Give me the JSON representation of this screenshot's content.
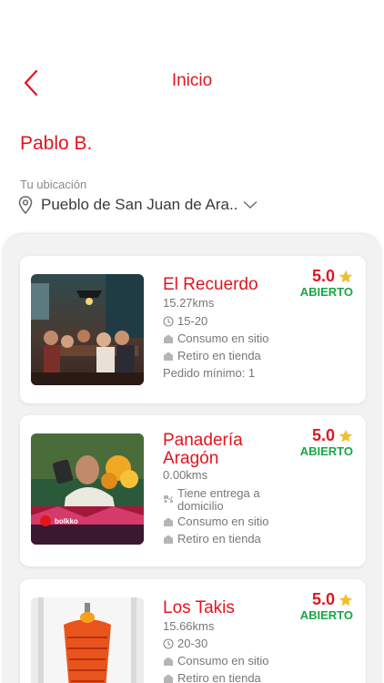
{
  "header": {
    "title": "Inicio",
    "back_icon": "chevron-left-icon"
  },
  "user": {
    "name": "Pablo B."
  },
  "location": {
    "label": "Tu ubicación",
    "value": "Pueblo de San Juan de Ara..",
    "icon": "location-pin-icon"
  },
  "colors": {
    "brand": "#e3141d",
    "open": "#19a646",
    "star": "#f2bd2f"
  },
  "restaurants": [
    {
      "name": "El Recuerdo",
      "distance": "15.27kms",
      "rating": "5.0",
      "status": "ABIERTO",
      "time": "15-20",
      "features": [
        "Consumo en sitio",
        "Retiro en tienda"
      ],
      "min_order": "Pedido mínimo: 1"
    },
    {
      "name_line1": "Panadería",
      "name_line2": "Aragón",
      "distance": "0.00kms",
      "rating": "5.0",
      "status": "ABIERTO",
      "delivery": "Tiene entrega a domicilio",
      "features": [
        "Consumo en sitio",
        "Retiro en tienda"
      ],
      "image_brand": "bolkko"
    },
    {
      "name": "Los Takis",
      "distance": "15.66kms",
      "rating": "5.0",
      "status": "ABIERTO",
      "time": "20-30",
      "features": [
        "Consumo en sitio",
        "Retiro en tienda"
      ]
    }
  ]
}
